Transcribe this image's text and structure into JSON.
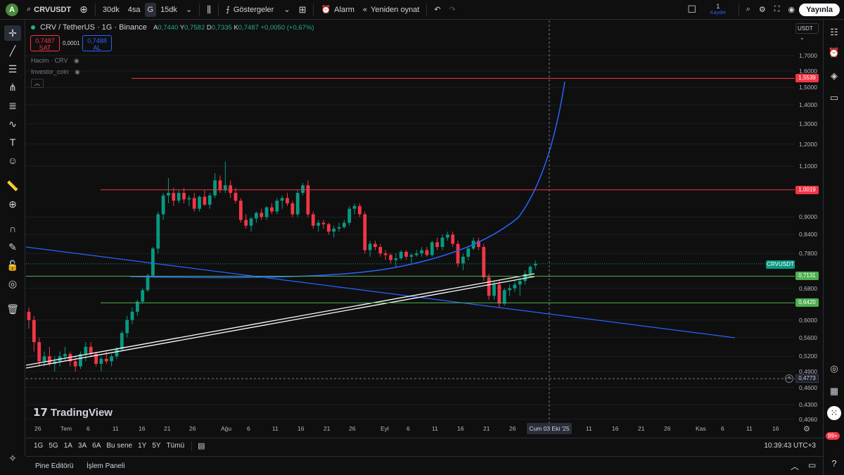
{
  "topbar": {
    "avatar_letter": "A",
    "symbol": "CRVUSDT",
    "intervals": [
      "30dk",
      "4sa",
      "G",
      "15dk"
    ],
    "indicators_label": "Göstergeler",
    "alarm_label": "Alarm",
    "replay_label": "Yeniden oynat",
    "save_count": "1",
    "save_label": "Kaydet",
    "publish_label": "Yayınla"
  },
  "legend": {
    "title": "CRV / TetherUS · 1G · Binance",
    "o_label": "A",
    "o": "0,7440",
    "h_label": "Y",
    "h": "0,7582",
    "l_label": "D",
    "l": "0,7335",
    "c_label": "K",
    "c": "0,7487",
    "change": "+0,0050 (+0,67%)",
    "sell_price": "0,7487",
    "sell_label": "SAT",
    "spread": "0,0001",
    "buy_price": "0,7488",
    "buy_label": "AL",
    "volume_label": "Hacim · CRV",
    "indicator_label": "Investor_coin"
  },
  "price_axis": {
    "currency": "USDT",
    "ticks": [
      {
        "label": "1,7000",
        "v": 1.7
      },
      {
        "label": "1,6000",
        "v": 1.6
      },
      {
        "label": "1,5000",
        "v": 1.5
      },
      {
        "label": "1,4000",
        "v": 1.4
      },
      {
        "label": "1,3000",
        "v": 1.3
      },
      {
        "label": "1,2000",
        "v": 1.2
      },
      {
        "label": "1,1000",
        "v": 1.1
      },
      {
        "label": "0,9000",
        "v": 0.9
      },
      {
        "label": "0,8400",
        "v": 0.84
      },
      {
        "label": "0,7800",
        "v": 0.78
      },
      {
        "label": "0,6800",
        "v": 0.68
      },
      {
        "label": "0,6000",
        "v": 0.6
      },
      {
        "label": "0,5600",
        "v": 0.56
      },
      {
        "label": "0,5200",
        "v": 0.52
      },
      {
        "label": "0,4900",
        "v": 0.49
      },
      {
        "label": "0,4600",
        "v": 0.46
      },
      {
        "label": "0,4300",
        "v": 0.43
      },
      {
        "label": "0,4060",
        "v": 0.406
      }
    ],
    "flags": [
      {
        "label": "1,5539",
        "v": 1.5539,
        "color": "#f23645"
      },
      {
        "label": "1,0019",
        "v": 1.0019,
        "color": "#f23645"
      },
      {
        "label": "0,7131",
        "v": 0.7131,
        "color": "#4caf50"
      },
      {
        "label": "0,6420",
        "v": 0.642,
        "color": "#4caf50"
      }
    ],
    "symbol_flag": "CRVUSDT",
    "crosshair_price": "0,4773"
  },
  "time_axis": {
    "ticks": [
      "26",
      "Tem",
      "6",
      "11",
      "16",
      "21",
      "26",
      "Ağu",
      "6",
      "11",
      "16",
      "21",
      "26",
      "Eyl",
      "6",
      "11",
      "16",
      "21",
      "26",
      "11",
      "16",
      "21",
      "26",
      "Kas",
      "6",
      "11",
      "16"
    ],
    "crosshair_date": "Cum 03 Eki '25"
  },
  "ranges": [
    "1G",
    "5G",
    "1A",
    "3A",
    "6A",
    "Bu sene",
    "1Y",
    "5Y",
    "Tümü"
  ],
  "clock": "10:39:43 UTC+3",
  "bottom_tabs": {
    "pine": "Pine Editörü",
    "trading": "İşlem Paneli"
  },
  "right_badge": "99+",
  "watermark": "TradingView",
  "colors": {
    "up": "#089981",
    "down": "#f23645",
    "resistance": "#f23645",
    "support": "#4caf50",
    "trend": "#2962ff"
  },
  "chart_data": {
    "type": "candlestick",
    "symbol": "CRVUSDT",
    "candles": [
      [
        0.62,
        0.63,
        0.58,
        0.6
      ],
      [
        0.6,
        0.61,
        0.53,
        0.55
      ],
      [
        0.55,
        0.56,
        0.5,
        0.51
      ],
      [
        0.51,
        0.53,
        0.5,
        0.52
      ],
      [
        0.52,
        0.54,
        0.5,
        0.505
      ],
      [
        0.505,
        0.52,
        0.49,
        0.51
      ],
      [
        0.51,
        0.53,
        0.5,
        0.52
      ],
      [
        0.52,
        0.54,
        0.51,
        0.525
      ],
      [
        0.525,
        0.53,
        0.5,
        0.51
      ],
      [
        0.51,
        0.52,
        0.49,
        0.5
      ],
      [
        0.5,
        0.53,
        0.495,
        0.525
      ],
      [
        0.525,
        0.55,
        0.51,
        0.54
      ],
      [
        0.54,
        0.55,
        0.52,
        0.525
      ],
      [
        0.525,
        0.53,
        0.5,
        0.505
      ],
      [
        0.505,
        0.52,
        0.49,
        0.515
      ],
      [
        0.515,
        0.53,
        0.505,
        0.51
      ],
      [
        0.51,
        0.525,
        0.5,
        0.52
      ],
      [
        0.52,
        0.54,
        0.515,
        0.535
      ],
      [
        0.535,
        0.575,
        0.53,
        0.57
      ],
      [
        0.57,
        0.61,
        0.56,
        0.6
      ],
      [
        0.6,
        0.63,
        0.59,
        0.62
      ],
      [
        0.62,
        0.65,
        0.61,
        0.645
      ],
      [
        0.645,
        0.68,
        0.64,
        0.675
      ],
      [
        0.675,
        0.72,
        0.67,
        0.715
      ],
      [
        0.715,
        0.8,
        0.71,
        0.795
      ],
      [
        0.795,
        0.92,
        0.78,
        0.91
      ],
      [
        0.91,
        0.99,
        0.89,
        0.98
      ],
      [
        0.98,
        1.05,
        0.95,
        0.99
      ],
      [
        0.99,
        1.01,
        0.94,
        0.96
      ],
      [
        0.96,
        1.0,
        0.95,
        0.99
      ],
      [
        0.99,
        1.01,
        0.95,
        0.965
      ],
      [
        0.965,
        0.98,
        0.94,
        0.97
      ],
      [
        0.97,
        0.99,
        0.92,
        0.93
      ],
      [
        0.93,
        0.98,
        0.92,
        0.975
      ],
      [
        0.975,
        1.0,
        0.94,
        0.945
      ],
      [
        0.945,
        0.99,
        0.93,
        0.98
      ],
      [
        0.98,
        1.07,
        0.97,
        1.04
      ],
      [
        1.04,
        1.06,
        0.99,
        1.0
      ],
      [
        1.0,
        1.12,
        0.99,
        1.02
      ],
      [
        1.02,
        1.04,
        0.97,
        0.99
      ],
      [
        0.99,
        1.01,
        0.95,
        0.96
      ],
      [
        0.96,
        0.97,
        0.88,
        0.89
      ],
      [
        0.89,
        0.91,
        0.86,
        0.87
      ],
      [
        0.87,
        0.9,
        0.85,
        0.895
      ],
      [
        0.895,
        0.92,
        0.88,
        0.915
      ],
      [
        0.915,
        0.93,
        0.89,
        0.9
      ],
      [
        0.9,
        0.94,
        0.89,
        0.935
      ],
      [
        0.935,
        0.95,
        0.91,
        0.92
      ],
      [
        0.92,
        0.97,
        0.91,
        0.96
      ],
      [
        0.96,
        0.98,
        0.93,
        0.97
      ],
      [
        0.97,
        0.99,
        0.94,
        0.95
      ],
      [
        0.95,
        0.96,
        0.9,
        0.91
      ],
      [
        0.91,
        1.0,
        0.9,
        0.99
      ],
      [
        0.99,
        1.03,
        0.98,
        1.02
      ],
      [
        1.02,
        1.04,
        0.9,
        0.91
      ],
      [
        0.91,
        0.92,
        0.86,
        0.87
      ],
      [
        0.87,
        0.89,
        0.85,
        0.88
      ],
      [
        0.88,
        0.89,
        0.86,
        0.875
      ],
      [
        0.875,
        0.88,
        0.84,
        0.85
      ],
      [
        0.85,
        0.87,
        0.83,
        0.86
      ],
      [
        0.86,
        0.88,
        0.85,
        0.865
      ],
      [
        0.865,
        0.89,
        0.86,
        0.88
      ],
      [
        0.88,
        0.94,
        0.87,
        0.93
      ],
      [
        0.93,
        0.95,
        0.91,
        0.94
      ],
      [
        0.94,
        0.95,
        0.9,
        0.91
      ],
      [
        0.91,
        0.92,
        0.78,
        0.79
      ],
      [
        0.79,
        0.82,
        0.77,
        0.81
      ],
      [
        0.81,
        0.82,
        0.79,
        0.8
      ],
      [
        0.8,
        0.81,
        0.77,
        0.78
      ],
      [
        0.78,
        0.79,
        0.76,
        0.775
      ],
      [
        0.775,
        0.78,
        0.75,
        0.76
      ],
      [
        0.76,
        0.78,
        0.74,
        0.765
      ],
      [
        0.765,
        0.79,
        0.76,
        0.785
      ],
      [
        0.785,
        0.79,
        0.76,
        0.77
      ],
      [
        0.77,
        0.78,
        0.75,
        0.775
      ],
      [
        0.775,
        0.79,
        0.77,
        0.78
      ],
      [
        0.78,
        0.8,
        0.77,
        0.79
      ],
      [
        0.79,
        0.8,
        0.77,
        0.775
      ],
      [
        0.775,
        0.82,
        0.77,
        0.815
      ],
      [
        0.815,
        0.83,
        0.79,
        0.8
      ],
      [
        0.8,
        0.84,
        0.79,
        0.83
      ],
      [
        0.83,
        0.85,
        0.82,
        0.84
      ],
      [
        0.84,
        0.85,
        0.8,
        0.81
      ],
      [
        0.81,
        0.82,
        0.74,
        0.75
      ],
      [
        0.75,
        0.78,
        0.73,
        0.77
      ],
      [
        0.77,
        0.8,
        0.76,
        0.795
      ],
      [
        0.795,
        0.83,
        0.79,
        0.82
      ],
      [
        0.82,
        0.83,
        0.79,
        0.8
      ],
      [
        0.8,
        0.81,
        0.7,
        0.71
      ],
      [
        0.71,
        0.72,
        0.65,
        0.66
      ],
      [
        0.66,
        0.7,
        0.65,
        0.69
      ],
      [
        0.69,
        0.7,
        0.63,
        0.64
      ],
      [
        0.64,
        0.68,
        0.635,
        0.675
      ],
      [
        0.675,
        0.69,
        0.66,
        0.68
      ],
      [
        0.68,
        0.7,
        0.67,
        0.69
      ],
      [
        0.69,
        0.71,
        0.66,
        0.7
      ],
      [
        0.7,
        0.73,
        0.69,
        0.72
      ],
      [
        0.72,
        0.745,
        0.71,
        0.74
      ],
      [
        0.744,
        0.7582,
        0.7335,
        0.7487
      ]
    ],
    "horizontal_levels": [
      1.5539,
      1.0019,
      0.7131,
      0.642
    ],
    "ylim": [
      0.4,
      1.75
    ],
    "log_scale": true
  }
}
